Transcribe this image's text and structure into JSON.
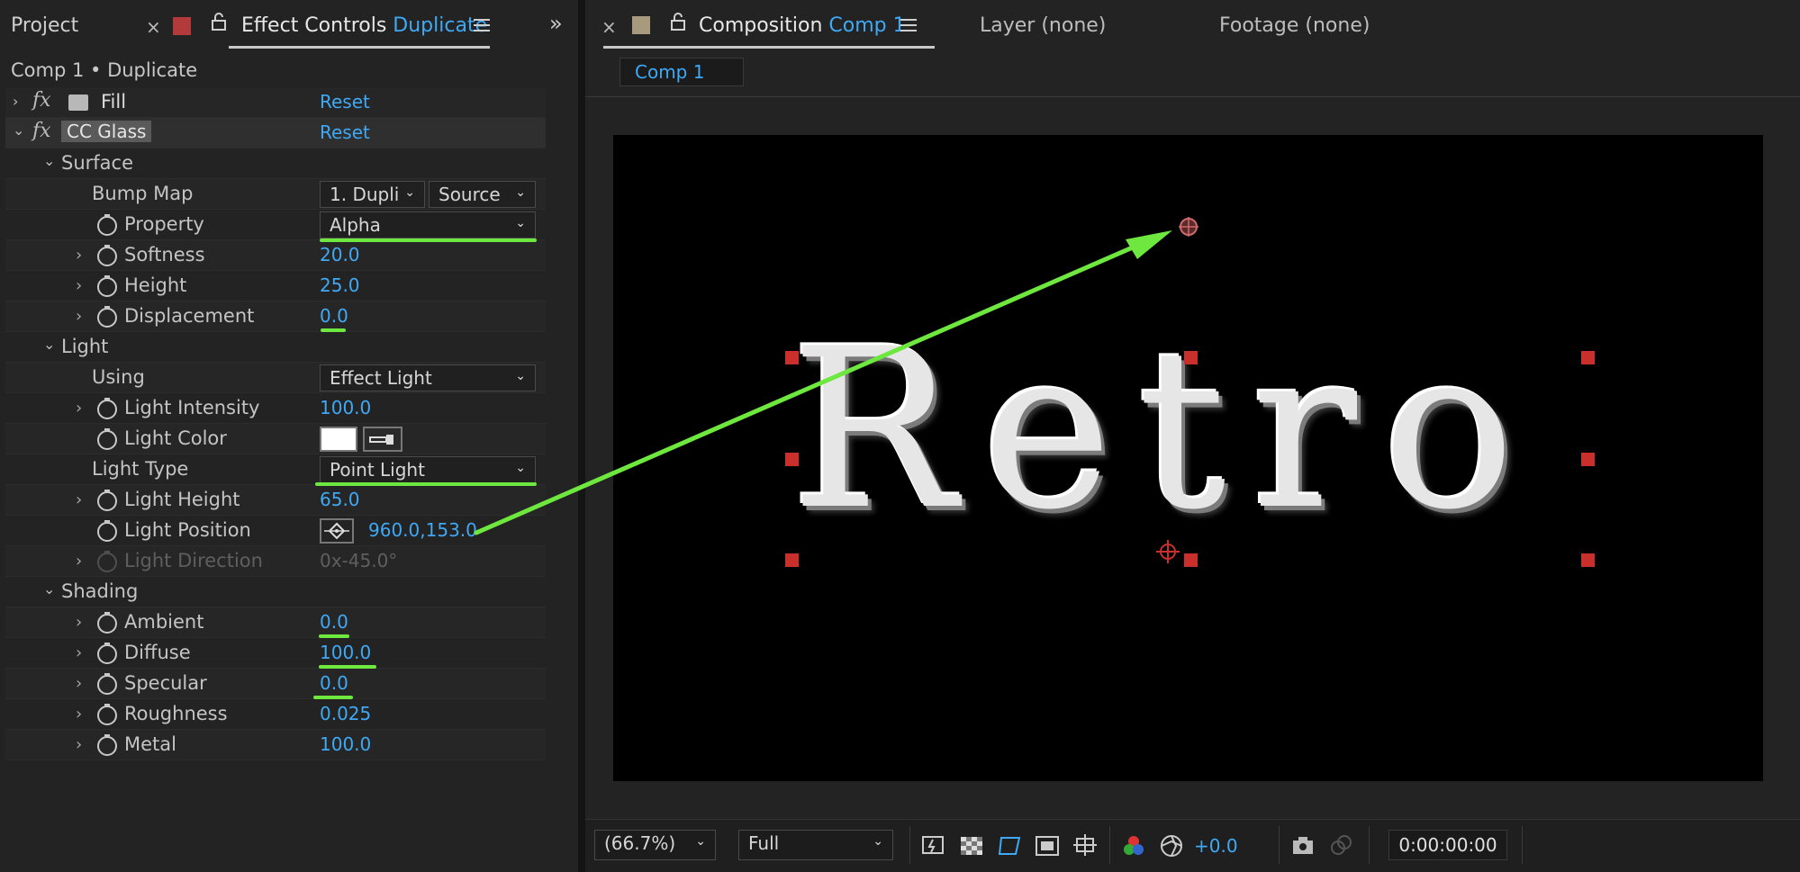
{
  "left_panel": {
    "tabs": {
      "project": "Project",
      "effect_controls_prefix": "Effect Controls",
      "effect_controls_layer": "Duplicate"
    },
    "breadcrumb": "Comp 1 • Duplicate",
    "effects": [
      {
        "name": "Fill",
        "reset": "Reset"
      },
      {
        "name": "CC Glass",
        "reset": "Reset"
      }
    ],
    "groups": {
      "surface": "Surface",
      "light": "Light",
      "shading": "Shading"
    },
    "surface": {
      "bump_map_label": "Bump Map",
      "bump_map_layer": "1. Dupli",
      "bump_map_source": "Source",
      "property_label": "Property",
      "property_value": "Alpha",
      "softness_label": "Softness",
      "softness_value": "20.0",
      "height_label": "Height",
      "height_value": "25.0",
      "displacement_label": "Displacement",
      "displacement_value": "0.0"
    },
    "light": {
      "using_label": "Using",
      "using_value": "Effect Light",
      "intensity_label": "Light Intensity",
      "intensity_value": "100.0",
      "color_label": "Light Color",
      "color_swatch": "#ffffff",
      "type_label": "Light Type",
      "type_value": "Point Light",
      "height_label": "Light Height",
      "height_value": "65.0",
      "position_label": "Light Position",
      "position_value": "960.0,153.0",
      "direction_label": "Light Direction",
      "direction_value": "0x-45.0°"
    },
    "shading": {
      "ambient_label": "Ambient",
      "ambient_value": "0.0",
      "diffuse_label": "Diffuse",
      "diffuse_value": "100.0",
      "specular_label": "Specular",
      "specular_value": "0.0",
      "roughness_label": "Roughness",
      "roughness_value": "0.025",
      "metal_label": "Metal",
      "metal_value": "100.0"
    }
  },
  "right_panel": {
    "tabs": {
      "composition_prefix": "Composition",
      "composition_name": "Comp 1",
      "layer": "Layer (none)",
      "footage": "Footage (none)"
    },
    "comp_tab": "Comp 1",
    "canvas_text": "Retro",
    "toolbar": {
      "zoom": "(66.7%)",
      "resolution": "Full",
      "exposure": "+0.0",
      "timecode": "0:00:00:00"
    }
  },
  "colors": {
    "accent_blue": "#3fa9f5",
    "annotation_green": "#6ee83f",
    "handle_red": "#c9302c",
    "label_swatch": "#b33a3a",
    "comp_swatch": "#a89a7c"
  },
  "icons": [
    "close-icon",
    "lock-icon",
    "menu-icon",
    "expand-panels-icon",
    "fx-icon",
    "stopwatch-icon",
    "eyedropper-icon",
    "crosshair-icon",
    "snapshot-icon"
  ]
}
